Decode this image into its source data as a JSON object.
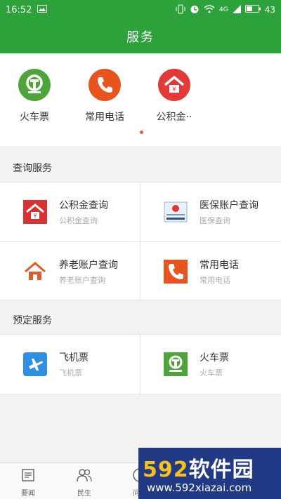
{
  "status_bar": {
    "time": "16:52",
    "network": "4G",
    "battery": "43"
  },
  "header": {
    "title": "服务"
  },
  "quick_links": [
    {
      "label": "火车票",
      "icon": "train-icon",
      "color": "#3f9a2f"
    },
    {
      "label": "常用电话",
      "icon": "phone-icon",
      "color": "#e8541e"
    },
    {
      "label": "公积金··",
      "icon": "house-icon",
      "color": "#d93030"
    }
  ],
  "query_section": {
    "title": "查询服务",
    "items": [
      {
        "title": "公积金查询",
        "subtitle": "公积金查询",
        "icon": "house-icon"
      },
      {
        "title": "医保账户查询",
        "subtitle": "医保查询",
        "icon": "medical-card-icon"
      },
      {
        "title": "养老账户查询",
        "subtitle": "养老账户查询",
        "icon": "pension-house-icon"
      },
      {
        "title": "常用电话",
        "subtitle": "常用电话",
        "icon": "phone-icon"
      }
    ]
  },
  "booking_section": {
    "title": "预定服务",
    "items": [
      {
        "title": "飞机票",
        "subtitle": "飞机票",
        "icon": "plane-icon"
      },
      {
        "title": "火车票",
        "subtitle": "火车票",
        "icon": "train-icon"
      }
    ]
  },
  "tab_bar": [
    {
      "label": "要闻",
      "icon": "news-icon"
    },
    {
      "label": "民生",
      "icon": "people-icon"
    },
    {
      "label": "问政",
      "icon": "question-icon"
    }
  ],
  "watermark": {
    "brand_digits": "592",
    "brand_text": "软件园",
    "url": "www.592xiazai.com"
  }
}
